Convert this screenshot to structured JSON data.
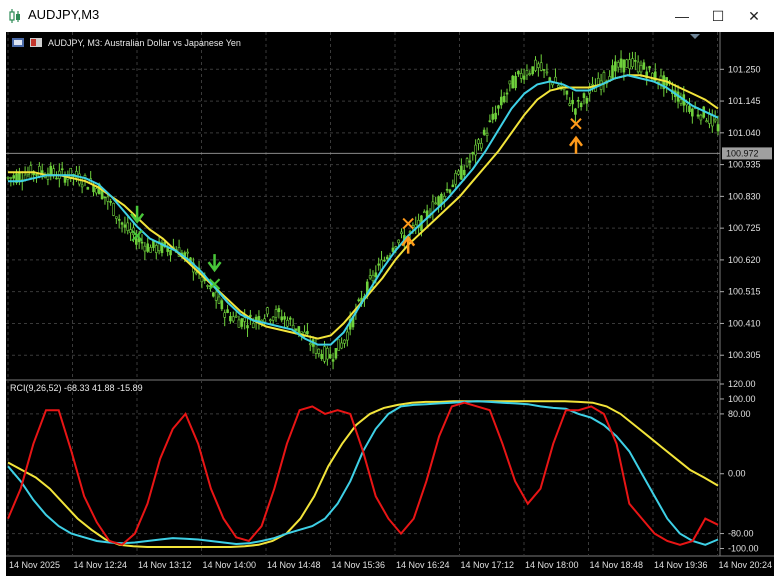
{
  "window": {
    "title": "AUDJPY,M3",
    "minimize_glyph": "—",
    "maximize_glyph": "☐",
    "close_glyph": "✕",
    "app_icon": "candlestick-icon"
  },
  "price_panel": {
    "legend": "AUDJPY, M3:  Australian Dollar vs Japanese Yen",
    "current_price": "100.972",
    "y_ticks": [
      "101.250",
      "101.145",
      "101.040",
      "100.935",
      "100.830",
      "100.725",
      "100.620",
      "100.515",
      "100.410",
      "100.305"
    ],
    "ylim": [
      100.233,
      101.327
    ]
  },
  "rci_panel": {
    "legend": "RCI(9,26,52) -68.33 41.88 -15.89",
    "y_ticks": [
      "120.00",
      "100.00",
      "80.00",
      "0.00",
      "-80.00",
      "-100.00"
    ],
    "ylim": [
      -110,
      120
    ]
  },
  "time_axis": {
    "labels": [
      "14 Nov 2025",
      "14 Nov 12:24",
      "14 Nov 13:12",
      "14 Nov 14:00",
      "14 Nov 14:48",
      "14 Nov 15:36",
      "14 Nov 16:24",
      "14 Nov 17:12",
      "14 Nov 18:00",
      "14 Nov 18:48",
      "14 Nov 19:36",
      "14 Nov 20:24"
    ]
  },
  "colors": {
    "background": "#000000",
    "grid": "#3a3a3a",
    "candles": "#6fd13c",
    "ma_fast": "#3ed0e6",
    "ma_slow": "#f2e43a",
    "rci_short": "#e81515",
    "rci_mid": "#3ed0e6",
    "rci_long": "#f2e43a",
    "sell_arrow": "#49c63a",
    "buy_arrow": "#ff9a1a"
  },
  "chart_data": {
    "type": "line",
    "price_series": {
      "close": [
        100.89,
        100.9,
        100.91,
        100.91,
        100.9,
        100.9,
        100.88,
        100.86,
        100.8,
        100.73,
        100.69,
        100.66,
        100.66,
        100.66,
        100.62,
        100.56,
        100.5,
        100.44,
        100.42,
        100.42,
        100.44,
        100.44,
        100.41,
        100.37,
        100.32,
        100.3,
        100.35,
        100.45,
        100.54,
        100.61,
        100.68,
        100.7,
        100.74,
        100.8,
        100.85,
        100.9,
        100.96,
        101.04,
        101.12,
        101.2,
        101.24,
        101.26,
        101.22,
        101.18,
        101.12,
        101.17,
        101.21,
        101.25,
        101.27,
        101.26,
        101.23,
        101.2,
        101.16,
        101.12,
        101.1,
        101.06
      ],
      "ma_fast": [
        100.88,
        100.88,
        100.89,
        100.9,
        100.9,
        100.9,
        100.89,
        100.87,
        100.83,
        100.78,
        100.73,
        100.69,
        100.67,
        100.65,
        100.62,
        100.58,
        100.53,
        100.48,
        100.44,
        100.42,
        100.41,
        100.4,
        100.39,
        100.36,
        100.34,
        100.34,
        100.38,
        100.45,
        100.52,
        100.59,
        100.65,
        100.7,
        100.74,
        100.78,
        100.82,
        100.87,
        100.92,
        100.98,
        101.05,
        101.12,
        101.17,
        101.2,
        101.21,
        101.2,
        101.18,
        101.18,
        101.2,
        101.22,
        101.23,
        101.22,
        101.21,
        101.19,
        101.16,
        101.13,
        101.11,
        101.09
      ],
      "ma_slow": [
        100.91,
        100.91,
        100.91,
        100.9,
        100.9,
        100.89,
        100.88,
        100.86,
        100.83,
        100.8,
        100.76,
        100.72,
        100.69,
        100.65,
        100.61,
        100.57,
        100.53,
        100.49,
        100.45,
        100.42,
        100.4,
        100.39,
        100.38,
        100.37,
        100.36,
        100.37,
        100.41,
        100.46,
        100.51,
        100.56,
        100.62,
        100.67,
        100.71,
        100.75,
        100.79,
        100.83,
        100.88,
        100.93,
        100.98,
        101.04,
        101.1,
        101.15,
        101.18,
        101.19,
        101.19,
        101.19,
        101.2,
        101.22,
        101.23,
        101.23,
        101.22,
        101.21,
        101.19,
        101.17,
        101.15,
        101.12
      ]
    },
    "signals": [
      {
        "type": "sell",
        "index": 10,
        "price": 100.7
      },
      {
        "type": "sell",
        "index": 16,
        "price": 100.54
      },
      {
        "type": "buy",
        "index": 31,
        "price": 100.74
      },
      {
        "type": "buy",
        "index": 44,
        "price": 101.07
      }
    ],
    "rci_series": {
      "rci_short": [
        -60,
        -20,
        40,
        85,
        85,
        30,
        -30,
        -65,
        -90,
        -95,
        -80,
        -40,
        20,
        60,
        80,
        40,
        -20,
        -60,
        -85,
        -90,
        -70,
        -20,
        40,
        85,
        90,
        80,
        85,
        80,
        30,
        -30,
        -60,
        -80,
        -60,
        -10,
        50,
        90,
        95,
        90,
        85,
        40,
        -10,
        -40,
        -20,
        40,
        85,
        85,
        90,
        80,
        40,
        -40,
        -60,
        -80,
        -90,
        -95,
        -90,
        -60,
        -68.33
      ],
      "rci_mid": [
        10,
        -10,
        -35,
        -55,
        -70,
        -80,
        -85,
        -90,
        -92,
        -93,
        -92,
        -90,
        -88,
        -86,
        -87,
        -88,
        -90,
        -92,
        -94,
        -93,
        -90,
        -86,
        -80,
        -75,
        -70,
        -60,
        -40,
        -10,
        30,
        60,
        80,
        90,
        92,
        93,
        94,
        95,
        96,
        97,
        96,
        95,
        94,
        93,
        90,
        88,
        87,
        80,
        75,
        65,
        50,
        30,
        0,
        -30,
        -60,
        -80,
        -90,
        -95,
        -88
      ],
      "rci_long": [
        15,
        5,
        -5,
        -20,
        -40,
        -60,
        -75,
        -88,
        -95,
        -97,
        -98,
        -98,
        -98,
        -98,
        -98,
        -98,
        -98,
        -97,
        -95,
        -90,
        -80,
        -60,
        -30,
        10,
        40,
        65,
        80,
        88,
        92,
        95,
        96,
        96,
        97,
        97,
        97,
        97,
        97,
        97,
        97,
        97,
        97,
        96,
        95,
        90,
        80,
        65,
        50,
        35,
        20,
        5,
        -5,
        -15.89
      ]
    }
  }
}
